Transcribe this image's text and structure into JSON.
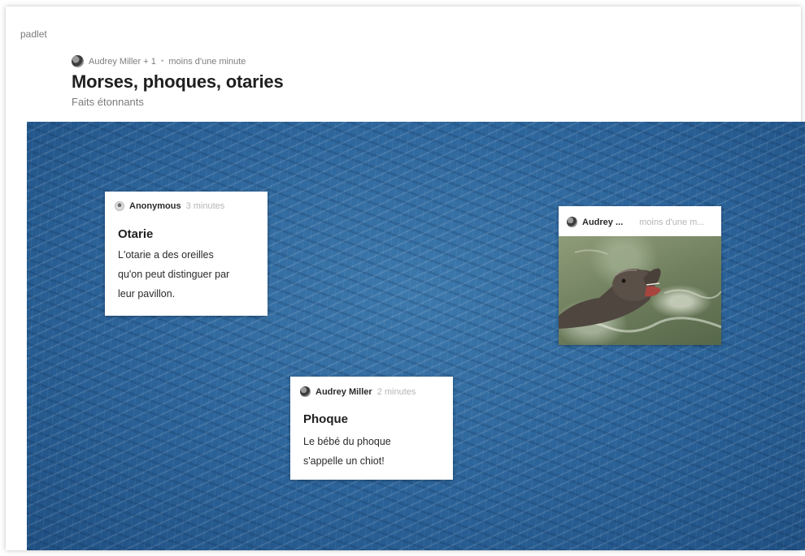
{
  "brand": "padlet",
  "header": {
    "authors": "Audrey Miller + 1",
    "separator": "•",
    "time": "moins d'une minute",
    "title": "Morses, phoques, otaries",
    "subtitle": "Faits étonnants"
  },
  "posts": [
    {
      "author": "Anonymous",
      "time": "3 minutes",
      "title": "Otarie",
      "body": [
        "L'otarie a des oreilles",
        "qu'on peut distinguer par",
        "leur pavillon."
      ]
    },
    {
      "author": "Audrey ...",
      "time": "moins d'une m...",
      "image": "sea-lion-photo"
    },
    {
      "author": "Audrey Miller",
      "time": "2 minutes",
      "title": "Phoque",
      "body": [
        "Le bébé du phoque",
        "s'appelle un chiot!"
      ]
    }
  ],
  "colors": {
    "water": "#2b6399",
    "card": "#ffffff",
    "title_text": "#1f1f1f",
    "muted_text": "#7a7a7a"
  }
}
